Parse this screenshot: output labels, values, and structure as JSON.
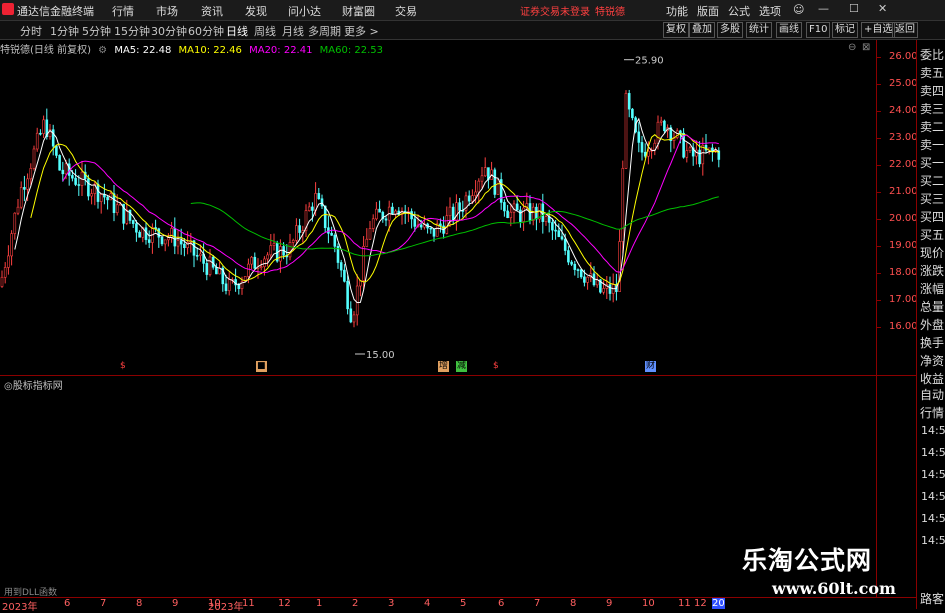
{
  "menubar": {
    "app_name": "通达信金融终端",
    "items": [
      "行情",
      "市场",
      "资讯",
      "发现",
      "问小达",
      "财富圈",
      "交易"
    ],
    "warning": "证券交易未登录",
    "stock_name": "特锐德",
    "right_items": [
      "功能",
      "版面",
      "公式",
      "选项"
    ],
    "window_controls": [
      "—",
      "☐",
      "✕"
    ]
  },
  "toolbar": {
    "periods": [
      "分时",
      "1分钟",
      "5分钟",
      "15分钟",
      "30分钟",
      "60分钟",
      "日线",
      "周线",
      "月线",
      "多周期",
      "更多 >"
    ],
    "active_period": "日线",
    "right_buttons": [
      "复权",
      "叠加",
      "多股",
      "统计",
      "画线",
      "F10",
      "标记",
      "+自选",
      "返回"
    ]
  },
  "chart_header": {
    "title": "特锐德(日线 前复权)",
    "ma5": "MA5: 22.48",
    "ma10": "MA10: 22.46",
    "ma20": "MA20: 22.41",
    "ma60": "MA60: 22.53"
  },
  "colors": {
    "ma5": "#ffffff",
    "ma10": "#ffff00",
    "ma20": "#ff00ff",
    "ma60": "#00c000",
    "up": "#ff4040",
    "down": "#54ffff",
    "axis": "#8b0000"
  },
  "y_axis_labels": [
    "26.00",
    "25.00",
    "24.00",
    "23.00",
    "22.00",
    "21.00",
    "20.00",
    "19.00",
    "18.00",
    "17.00",
    "16.00"
  ],
  "annotations": {
    "high": "25.90",
    "low": "15.00"
  },
  "events": [
    {
      "label": "$",
      "color": "#ff4040"
    },
    {
      "label": "■",
      "color": "#e0a060"
    },
    {
      "label": "增",
      "color": "#e0a060"
    },
    {
      "label": "减",
      "color": "#40c040"
    },
    {
      "label": "$",
      "color": "#ff4040"
    },
    {
      "label": "财",
      "color": "#6090ff"
    }
  ],
  "right_panel": {
    "quote_labels": [
      "委比",
      "卖五",
      "卖四",
      "卖三",
      "卖二",
      "卖一",
      "买一",
      "买二",
      "买三",
      "买四",
      "买五",
      "现价",
      "涨跌",
      "涨幅",
      "总量",
      "外盘",
      "换手",
      "净资",
      "收益"
    ],
    "lower_labels": [
      "自动",
      "行情"
    ],
    "times": [
      "14:50",
      "14:50",
      "14:50",
      "14:50",
      "14:50",
      "14:50"
    ],
    "bottom_text": "路客"
  },
  "indicator": {
    "title": "◎股标指标网",
    "hint": "用到DLL函数"
  },
  "x_axis": [
    "2023年",
    "6",
    "7",
    "8",
    "9",
    "10",
    "11",
    "12",
    "2023年",
    "11",
    "12",
    "1",
    "2",
    "3",
    "4",
    "5",
    "6",
    "7",
    "8",
    "9",
    "10",
    "11",
    "12",
    "20"
  ],
  "watermark": {
    "title": "乐淘公式网",
    "url": "www.60lt.com"
  }
}
